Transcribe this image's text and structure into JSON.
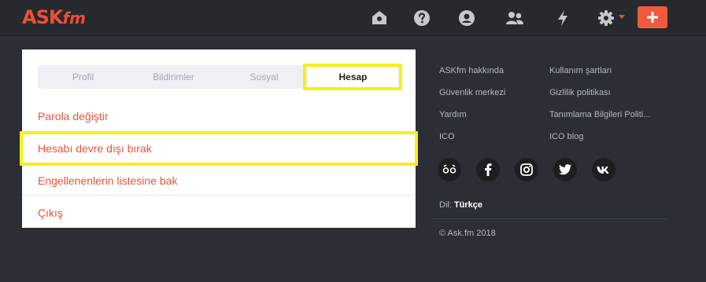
{
  "header": {
    "logo_main": "ASK",
    "logo_suffix": "fm",
    "icons": [
      "home-icon",
      "question-icon",
      "profile-icon",
      "friends-icon",
      "lightning-icon",
      "gear-icon",
      "plus-icon"
    ]
  },
  "settings": {
    "tabs": [
      {
        "label": "Profil"
      },
      {
        "label": "Bildirimler"
      },
      {
        "label": "Sosyal"
      },
      {
        "label": "Hesap"
      }
    ],
    "active_tab": "Hesap",
    "menu": [
      {
        "label": "Parola değiştir"
      },
      {
        "label": "Hesabı devre dışı bırak"
      },
      {
        "label": "Engellenenlerin listesine bak"
      },
      {
        "label": "Çıkış"
      }
    ]
  },
  "footer": {
    "links_left": [
      "ASKfm hakkında",
      "Güvenlik merkezi",
      "Yardım",
      "ICO"
    ],
    "links_right": [
      "Kullanım şartları",
      "Gizlilik politikası",
      "Tanımlama Bilgileri Politi...",
      "ICO blog"
    ],
    "social": [
      "askfm-icon",
      "facebook-icon",
      "instagram-icon",
      "twitter-icon",
      "vk-icon"
    ],
    "language_label": "Dil:",
    "language_value": "Türkçe",
    "copyright": "© Ask.fm 2018"
  },
  "colors": {
    "accent": "#ee5a3b",
    "highlight": "#f7ee1c",
    "background": "#2b2e34"
  }
}
